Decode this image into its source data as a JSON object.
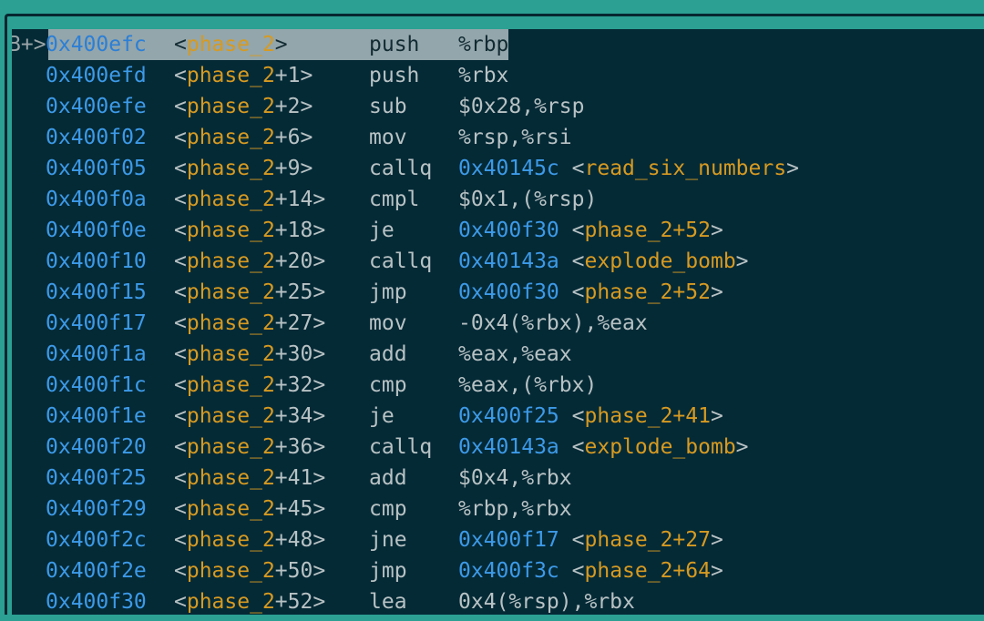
{
  "window": {
    "frame_color": "#2ba093",
    "border_color": "#062630",
    "panel_bg": "#042a36"
  },
  "theme": {
    "address_color": "#3d9ae8",
    "symbol_color": "#d79a21",
    "punctuation_color": "#b8c2c4",
    "mnemonic_color": "#b8c2c4",
    "highlight_bg": "#93a6ab",
    "highlight_fg": "#122b33",
    "marker_color": "#9aa5a8"
  },
  "disassembly": {
    "function": "phase_2",
    "current_marker": "B+>",
    "lines": [
      {
        "marker": "B+>",
        "current": true,
        "address": "0x400efc",
        "sym_open": "<",
        "sym_name": "phase_2",
        "sym_off": "",
        "sym_close": ">",
        "mnemonic": "push",
        "operands": "%rbp",
        "target_addr": "",
        "target_open": "",
        "target_name": "",
        "target_close": ""
      },
      {
        "marker": "",
        "current": false,
        "address": "0x400efd",
        "sym_open": "<",
        "sym_name": "phase_2",
        "sym_off": "+1",
        "sym_close": ">",
        "mnemonic": "push",
        "operands": "%rbx",
        "target_addr": "",
        "target_open": "",
        "target_name": "",
        "target_close": ""
      },
      {
        "marker": "",
        "current": false,
        "address": "0x400efe",
        "sym_open": "<",
        "sym_name": "phase_2",
        "sym_off": "+2",
        "sym_close": ">",
        "mnemonic": "sub",
        "operands": "$0x28,%rsp",
        "target_addr": "",
        "target_open": "",
        "target_name": "",
        "target_close": ""
      },
      {
        "marker": "",
        "current": false,
        "address": "0x400f02",
        "sym_open": "<",
        "sym_name": "phase_2",
        "sym_off": "+6",
        "sym_close": ">",
        "mnemonic": "mov",
        "operands": "%rsp,%rsi",
        "target_addr": "",
        "target_open": "",
        "target_name": "",
        "target_close": ""
      },
      {
        "marker": "",
        "current": false,
        "address": "0x400f05",
        "sym_open": "<",
        "sym_name": "phase_2",
        "sym_off": "+9",
        "sym_close": ">",
        "mnemonic": "callq",
        "operands": "",
        "target_addr": "0x40145c",
        "target_open": "<",
        "target_name": "read_six_numbers",
        "target_close": ">"
      },
      {
        "marker": "",
        "current": false,
        "address": "0x400f0a",
        "sym_open": "<",
        "sym_name": "phase_2",
        "sym_off": "+14",
        "sym_close": ">",
        "mnemonic": "cmpl",
        "operands": "$0x1,(%rsp)",
        "target_addr": "",
        "target_open": "",
        "target_name": "",
        "target_close": ""
      },
      {
        "marker": "",
        "current": false,
        "address": "0x400f0e",
        "sym_open": "<",
        "sym_name": "phase_2",
        "sym_off": "+18",
        "sym_close": ">",
        "mnemonic": "je",
        "operands": "",
        "target_addr": "0x400f30",
        "target_open": "<",
        "target_name": "phase_2+52",
        "target_close": ">"
      },
      {
        "marker": "",
        "current": false,
        "address": "0x400f10",
        "sym_open": "<",
        "sym_name": "phase_2",
        "sym_off": "+20",
        "sym_close": ">",
        "mnemonic": "callq",
        "operands": "",
        "target_addr": "0x40143a",
        "target_open": "<",
        "target_name": "explode_bomb",
        "target_close": ">"
      },
      {
        "marker": "",
        "current": false,
        "address": "0x400f15",
        "sym_open": "<",
        "sym_name": "phase_2",
        "sym_off": "+25",
        "sym_close": ">",
        "mnemonic": "jmp",
        "operands": "",
        "target_addr": "0x400f30",
        "target_open": "<",
        "target_name": "phase_2+52",
        "target_close": ">"
      },
      {
        "marker": "",
        "current": false,
        "address": "0x400f17",
        "sym_open": "<",
        "sym_name": "phase_2",
        "sym_off": "+27",
        "sym_close": ">",
        "mnemonic": "mov",
        "operands": "-0x4(%rbx),%eax",
        "target_addr": "",
        "target_open": "",
        "target_name": "",
        "target_close": ""
      },
      {
        "marker": "",
        "current": false,
        "address": "0x400f1a",
        "sym_open": "<",
        "sym_name": "phase_2",
        "sym_off": "+30",
        "sym_close": ">",
        "mnemonic": "add",
        "operands": "%eax,%eax",
        "target_addr": "",
        "target_open": "",
        "target_name": "",
        "target_close": ""
      },
      {
        "marker": "",
        "current": false,
        "address": "0x400f1c",
        "sym_open": "<",
        "sym_name": "phase_2",
        "sym_off": "+32",
        "sym_close": ">",
        "mnemonic": "cmp",
        "operands": "%eax,(%rbx)",
        "target_addr": "",
        "target_open": "",
        "target_name": "",
        "target_close": ""
      },
      {
        "marker": "",
        "current": false,
        "address": "0x400f1e",
        "sym_open": "<",
        "sym_name": "phase_2",
        "sym_off": "+34",
        "sym_close": ">",
        "mnemonic": "je",
        "operands": "",
        "target_addr": "0x400f25",
        "target_open": "<",
        "target_name": "phase_2+41",
        "target_close": ">"
      },
      {
        "marker": "",
        "current": false,
        "address": "0x400f20",
        "sym_open": "<",
        "sym_name": "phase_2",
        "sym_off": "+36",
        "sym_close": ">",
        "mnemonic": "callq",
        "operands": "",
        "target_addr": "0x40143a",
        "target_open": "<",
        "target_name": "explode_bomb",
        "target_close": ">"
      },
      {
        "marker": "",
        "current": false,
        "address": "0x400f25",
        "sym_open": "<",
        "sym_name": "phase_2",
        "sym_off": "+41",
        "sym_close": ">",
        "mnemonic": "add",
        "operands": "$0x4,%rbx",
        "target_addr": "",
        "target_open": "",
        "target_name": "",
        "target_close": ""
      },
      {
        "marker": "",
        "current": false,
        "address": "0x400f29",
        "sym_open": "<",
        "sym_name": "phase_2",
        "sym_off": "+45",
        "sym_close": ">",
        "mnemonic": "cmp",
        "operands": "%rbp,%rbx",
        "target_addr": "",
        "target_open": "",
        "target_name": "",
        "target_close": ""
      },
      {
        "marker": "",
        "current": false,
        "address": "0x400f2c",
        "sym_open": "<",
        "sym_name": "phase_2",
        "sym_off": "+48",
        "sym_close": ">",
        "mnemonic": "jne",
        "operands": "",
        "target_addr": "0x400f17",
        "target_open": "<",
        "target_name": "phase_2+27",
        "target_close": ">"
      },
      {
        "marker": "",
        "current": false,
        "address": "0x400f2e",
        "sym_open": "<",
        "sym_name": "phase_2",
        "sym_off": "+50",
        "sym_close": ">",
        "mnemonic": "jmp",
        "operands": "",
        "target_addr": "0x400f3c",
        "target_open": "<",
        "target_name": "phase_2+64",
        "target_close": ">"
      },
      {
        "marker": "",
        "current": false,
        "address": "0x400f30",
        "sym_open": "<",
        "sym_name": "phase_2",
        "sym_off": "+52",
        "sym_close": ">",
        "mnemonic": "lea",
        "operands": "0x4(%rsp),%rbx",
        "target_addr": "",
        "target_open": "",
        "target_name": "",
        "target_close": ""
      }
    ]
  }
}
